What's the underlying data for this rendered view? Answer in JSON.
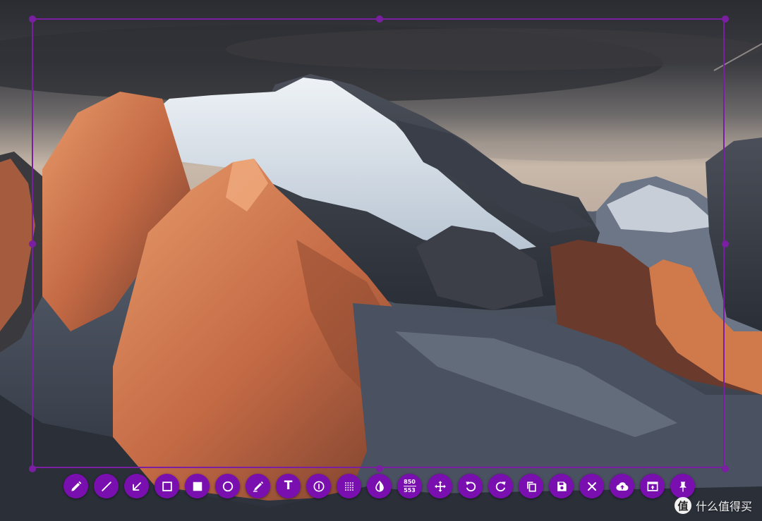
{
  "app": {
    "name": "screenshot-annotation-tool"
  },
  "colors": {
    "accent": "#7a0fb0",
    "selection_border": "#7a1fa2",
    "icon": "#ffffff"
  },
  "toolbar": {
    "tools": [
      {
        "id": "pen",
        "icon": "pencil-icon"
      },
      {
        "id": "line",
        "icon": "line-icon"
      },
      {
        "id": "arrow",
        "icon": "arrow-icon"
      },
      {
        "id": "rectangle",
        "icon": "rectangle-outline-icon"
      },
      {
        "id": "filled-rectangle",
        "icon": "rectangle-filled-icon"
      },
      {
        "id": "circle",
        "icon": "circle-icon"
      },
      {
        "id": "marker",
        "icon": "marker-icon"
      },
      {
        "id": "text",
        "icon": "text-icon",
        "label": "T"
      },
      {
        "id": "counter",
        "icon": "counter-icon"
      },
      {
        "id": "pixelate",
        "icon": "pixelate-icon"
      },
      {
        "id": "invert",
        "icon": "invert-icon"
      },
      {
        "id": "selection-size",
        "icon": "selection-size-icon",
        "width": "850",
        "height": "553"
      },
      {
        "id": "move",
        "icon": "move-icon"
      },
      {
        "id": "undo",
        "icon": "undo-icon"
      },
      {
        "id": "redo",
        "icon": "redo-icon"
      },
      {
        "id": "copy",
        "icon": "copy-icon"
      },
      {
        "id": "save",
        "icon": "save-icon"
      },
      {
        "id": "exit",
        "icon": "close-icon"
      },
      {
        "id": "upload",
        "icon": "cloud-upload-icon"
      },
      {
        "id": "app-launcher",
        "icon": "open-app-icon"
      },
      {
        "id": "pin",
        "icon": "pin-icon"
      }
    ]
  },
  "watermark": {
    "logo": "值",
    "text": "什么值得买"
  }
}
